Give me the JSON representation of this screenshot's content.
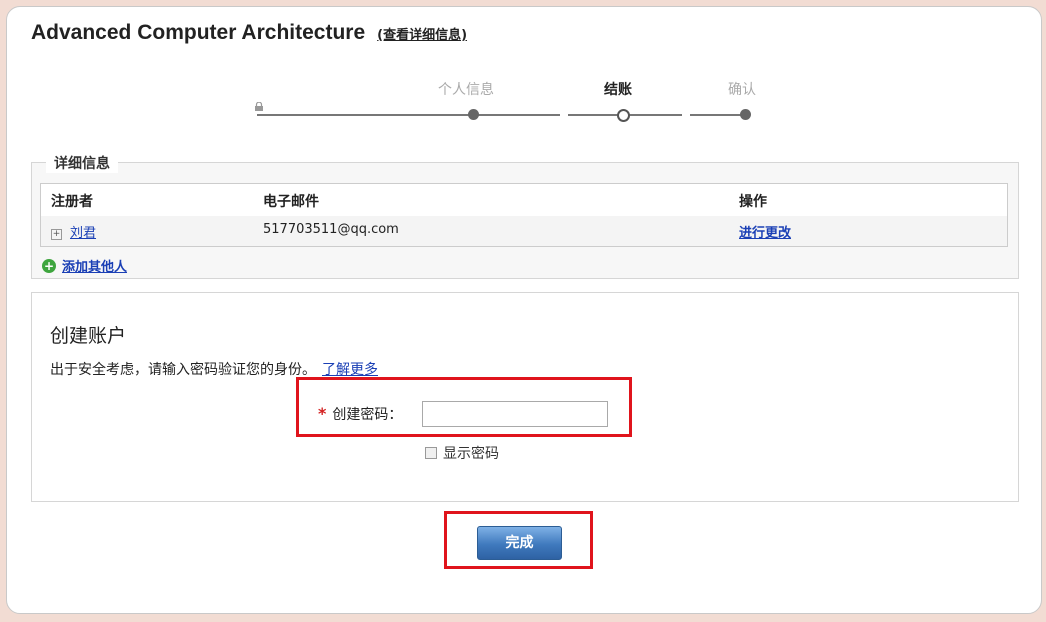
{
  "header": {
    "course_title": "Advanced Computer Architecture",
    "details_link": "(查看详细信息)"
  },
  "steps": [
    {
      "label": "个人信息",
      "state": "done"
    },
    {
      "label": "结账",
      "state": "current"
    },
    {
      "label": "确认",
      "state": "pending"
    }
  ],
  "details": {
    "legend": "详细信息",
    "columns": [
      "注册者",
      "电子邮件",
      "操作"
    ],
    "rows": [
      {
        "name": "刘君",
        "email": "517703511@qq.com",
        "action": "进行更改"
      }
    ],
    "add_link": "添加其他人"
  },
  "account": {
    "title": "创建账户",
    "description": "出于安全考虑，请输入密码验证您的身份。",
    "learn_more": "了解更多",
    "password_label": "创建密码：",
    "password_value": "",
    "show_password_label": "显示密码"
  },
  "finish_button": "完成",
  "colors": {
    "link": "#1a3fb5",
    "highlight": "#e0141c",
    "button": "#3f79bd",
    "required": "#d32020"
  }
}
